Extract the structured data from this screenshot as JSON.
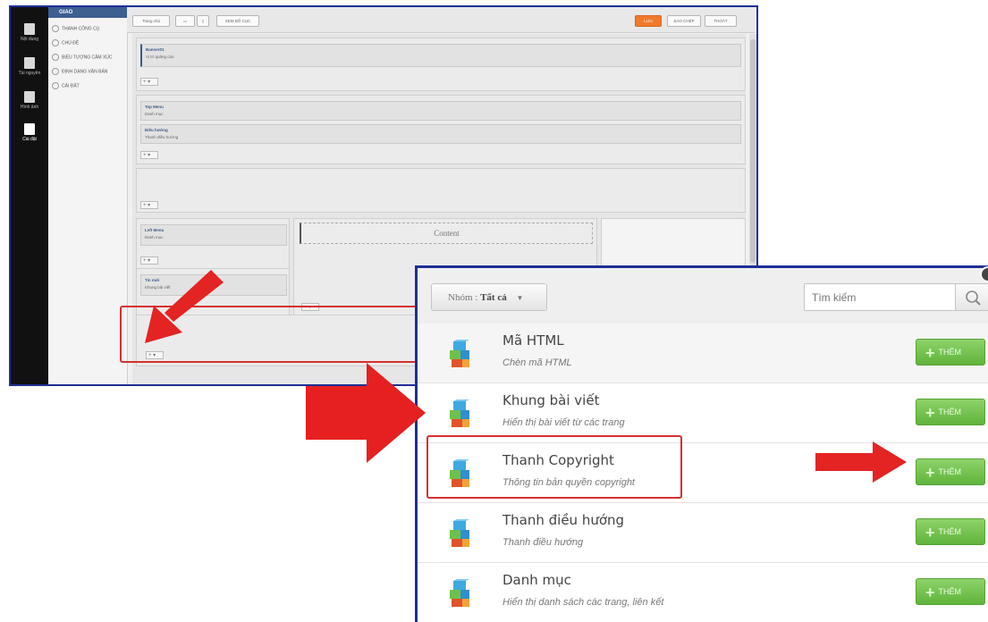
{
  "editor": {
    "rail": [
      {
        "label": "Nội dung"
      },
      {
        "label": "Tài nguyên"
      },
      {
        "label": "Hình ảnh"
      },
      {
        "label": "Cài đặt"
      }
    ],
    "menu_header": "GIAO",
    "menu": [
      {
        "label": "THANH CÔNG CỤ"
      },
      {
        "label": "CHỦ ĐỀ"
      },
      {
        "label": "BIỂU TƯỢNG CẢM XÚC"
      },
      {
        "label": "ĐỊNH DẠNG VĂN BẢN"
      },
      {
        "label": "CÀI ĐẶT"
      }
    ],
    "toolbar": {
      "layout_select": "Trang chủ",
      "preview_label": "XEM BỐ CỤC",
      "save_label": "LƯU",
      "second_label": "SAO CHÉP",
      "third_label": "THOÁT"
    },
    "modules": {
      "banner_title": "Banner01",
      "banner_sub": "Vị trí quảng cáo",
      "top_menu_title": "Top Menu",
      "top_menu_sub": "Danh mục",
      "nav_title": "Điều hướng",
      "nav_sub": "Thanh điều hướng",
      "left_menu_title": "Left Menu",
      "left_menu_sub": "Danh mục",
      "tin_moi_title": "Tin mới",
      "tin_moi_sub": "Khung bài viết",
      "content_placeholder": "Content"
    },
    "plus_label": "+ ▾"
  },
  "panel": {
    "group_prefix": "Nhóm : ",
    "group_value": "Tất cả",
    "search_placeholder": "Tìm kiếm",
    "add_label": "THÊM",
    "items": [
      {
        "title": "Mã HTML",
        "desc": "Chèn mã HTML"
      },
      {
        "title": "Khung bài viết",
        "desc": "Hiển thị bài viết từ các trang"
      },
      {
        "title": "Thanh Copyright",
        "desc": "Thông tin bản quyền copyright"
      },
      {
        "title": "Thanh điều hướng",
        "desc": "Thanh điều hướng"
      },
      {
        "title": "Danh mục",
        "desc": "Hiển thị danh sách các trang, liên kết"
      }
    ]
  },
  "colors": {
    "highlight_red": "#d63030",
    "frame_blue": "#1f2f95",
    "add_green": "#6cc045",
    "save_orange": "#f07a2c"
  }
}
